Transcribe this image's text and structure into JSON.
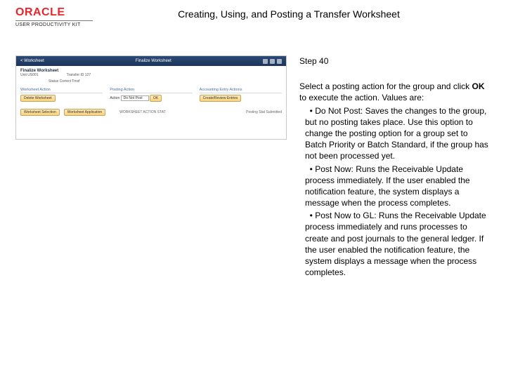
{
  "header": {
    "logo_text": "ORACLE",
    "logo_sub": "USER PRODUCTIVITY KIT",
    "title": "Creating, Using, and Posting a Transfer Worksheet"
  },
  "app": {
    "back_label": "< Worksheet",
    "titlebar": "Finalize Worksheet",
    "finalize": "Finalize Worksheet",
    "unit_label": "Unit US001",
    "transfer_label": "Transfer ID  127",
    "status_label": "Status  Correct Trnsf",
    "section_worksheet": "Worksheet Action",
    "section_posting": "Posting Action",
    "section_entry": "Accounting Entry Actions",
    "btn_delete": "Delete Worksheet",
    "action_label": "Action",
    "action_value": "Do Not Post",
    "btn_ok": "OK",
    "btn_create": "Create/Review Entries",
    "footer_btn1": "Worksheet Selection",
    "footer_btn2": "Worksheet Application",
    "footer_id": "WORKSHEET ACTION STAT",
    "footer_right": "Posting Stat  Submitted"
  },
  "instructions": {
    "step": "Step 40",
    "intro_a": "Select a posting action for the group and click ",
    "intro_ok": "OK",
    "intro_b": " to execute the action. Values are:",
    "b1_head": "Do Not Post:",
    "b1_body": " Saves the changes to the group, but no posting takes place. Use this option to change the posting option for a group set to Batch Priority or Batch Standard, if the group has not been processed yet.",
    "b2_head": "Post Now:",
    "b2_body": " Runs the Receivable Update process immediately. If the user enabled the notification feature, the system displays a message when the process completes.",
    "b3_head": "Post Now to GL:",
    "b3_body": " Runs the Receivable Update process immediately and runs processes to create and post journals to the general ledger. If the user enabled the notification feature, the system displays a message when the process completes."
  }
}
